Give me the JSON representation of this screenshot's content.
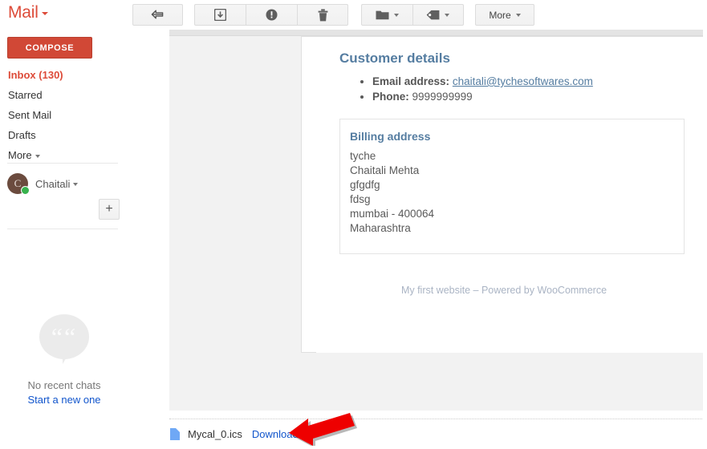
{
  "app": {
    "logo": "Mail",
    "accent_red": "#dd4b39",
    "link_blue": "#1155cc"
  },
  "toolbar": {
    "back_label": "back-arrow",
    "archive_label": "archive",
    "spam_label": "report-spam",
    "delete_label": "delete",
    "move_to_label": "move-to",
    "labels_label": "labels",
    "more_label": "More"
  },
  "sidebar": {
    "compose_label": "COMPOSE",
    "items": [
      {
        "label": "Inbox (130)",
        "active": true
      },
      {
        "label": "Starred",
        "active": false
      },
      {
        "label": "Sent Mail",
        "active": false
      },
      {
        "label": "Drafts",
        "active": false
      },
      {
        "label": "More",
        "active": false
      }
    ],
    "user": {
      "avatar_initial": "C",
      "name": "Chaitali",
      "status": "online",
      "add_label": "+"
    },
    "chat": {
      "empty_text": "No recent chats",
      "start_link": "Start a new one"
    }
  },
  "email": {
    "customer_details": {
      "heading": "Customer details",
      "items": [
        {
          "label": "Email address:",
          "value": "chaitali@tychesoftwares.com",
          "is_link": true
        },
        {
          "label": "Phone:",
          "value": "9999999999",
          "is_link": false
        }
      ]
    },
    "billing_address": {
      "heading": "Billing address",
      "lines": [
        "tyche",
        "Chaitali Mehta",
        "gfgdfg",
        "fdsg",
        "mumbai - 400064",
        "Maharashtra"
      ]
    },
    "footer": "My first website – Powered by WooCommerce"
  },
  "attachment": {
    "file_name": "Mycal_0.ics",
    "download_label": "Download",
    "file_icon": "file-icon",
    "annotation_arrow_color": "#ee0000"
  }
}
